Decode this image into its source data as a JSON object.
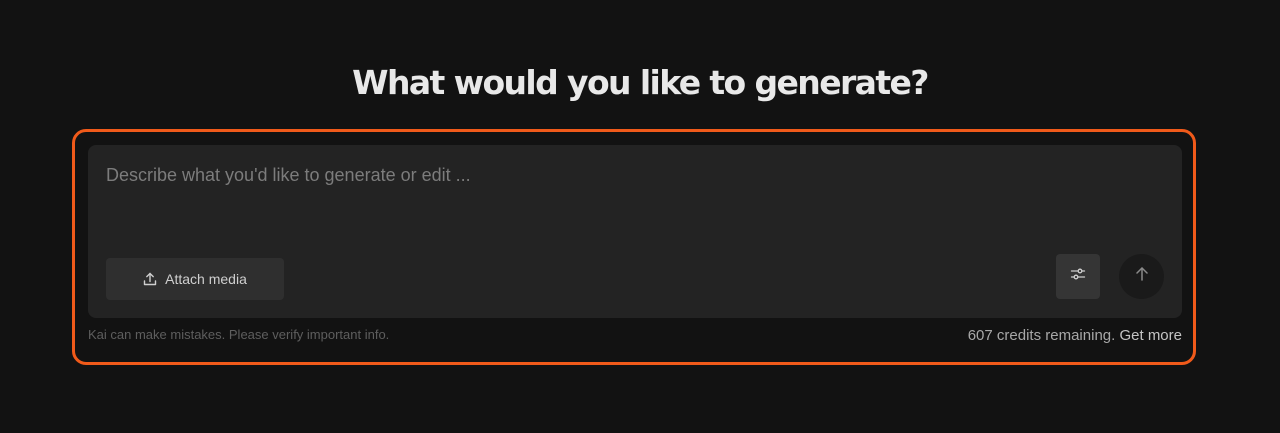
{
  "headline": "What would you like to generate?",
  "composer": {
    "placeholder": "Describe what you'd like to generate or edit ...",
    "value": "",
    "attach_label": "Attach media",
    "icons": {
      "attach": "upload-icon",
      "settings": "sliders-icon",
      "send": "arrow-up-icon"
    }
  },
  "footer": {
    "disclaimer": "Kai can make mistakes. Please verify important info.",
    "credits_text": "607 credits remaining.",
    "get_more_label": "Get more"
  },
  "colors": {
    "background": "#121212",
    "composer": "#232323",
    "highlight": "#f05a1a"
  }
}
